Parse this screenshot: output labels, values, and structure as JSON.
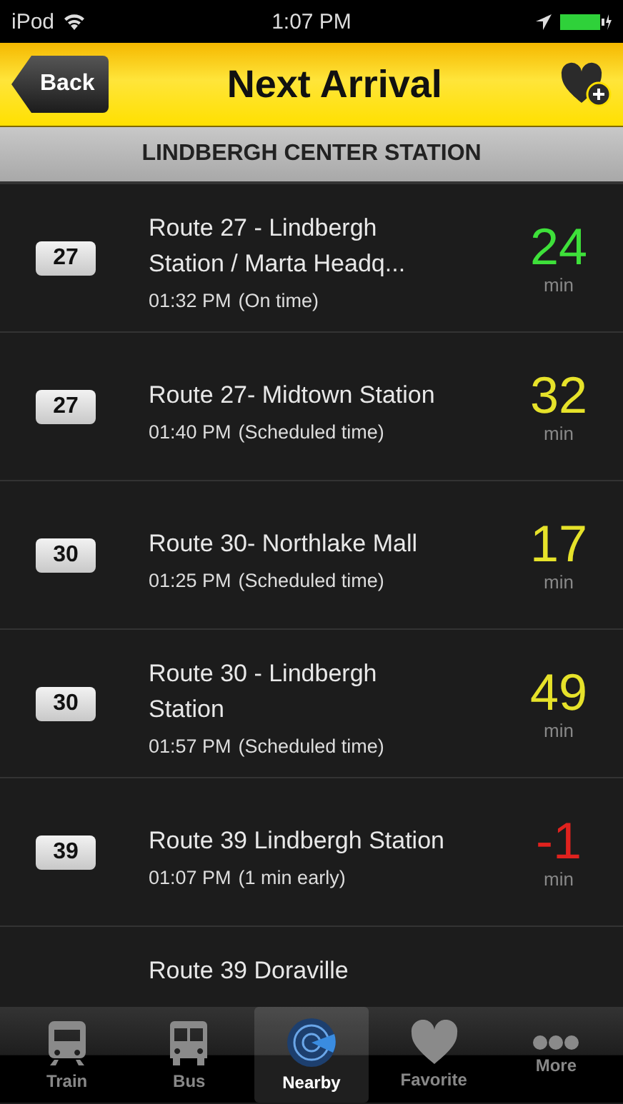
{
  "status_bar": {
    "device": "iPod",
    "time": "1:07 PM"
  },
  "nav_bar": {
    "back": "Back",
    "title": "Next Arrival"
  },
  "section": {
    "title": "LINDBERGH CENTER STATION"
  },
  "arrivals": [
    {
      "kind": "full",
      "route": "27",
      "title": "Route 27 - Lindbergh Station / Marta Headq...",
      "time": "01:32 PM",
      "note": "(On time)",
      "minutes": "24",
      "unit": "min",
      "color": "#3ee03a"
    },
    {
      "kind": "full",
      "route": "27",
      "title": "Route 27- Midtown Station",
      "time": "01:40 PM",
      "note": "(Scheduled time)",
      "minutes": "32",
      "unit": "min",
      "color": "#e6e22a"
    },
    {
      "kind": "full",
      "route": "30",
      "title": "Route 30- Northlake Mall",
      "time": "01:25 PM",
      "note": "(Scheduled time)",
      "minutes": "17",
      "unit": "min",
      "color": "#e6e22a"
    },
    {
      "kind": "full",
      "route": "30",
      "title": "Route 30 - Lindbergh Station",
      "time": "01:57 PM",
      "note": "(Scheduled time)",
      "minutes": "49",
      "unit": "min",
      "color": "#e6e22a"
    },
    {
      "kind": "full",
      "route": "39",
      "title": "Route 39 Lindbergh Station",
      "time": "01:07 PM",
      "note": "(1 min early)",
      "minutes": "-1",
      "unit": "min",
      "color": "#e0221e"
    },
    {
      "kind": "partial",
      "title": "Route 39 Doraville"
    }
  ],
  "tabs": [
    {
      "kind": "train",
      "label": "Train",
      "selected": false
    },
    {
      "kind": "bus",
      "label": "Bus",
      "selected": false
    },
    {
      "kind": "nearby",
      "label": "Nearby",
      "selected": true
    },
    {
      "kind": "favorite",
      "label": "Favorite",
      "selected": false
    },
    {
      "kind": "more",
      "label": "More",
      "selected": false
    }
  ]
}
